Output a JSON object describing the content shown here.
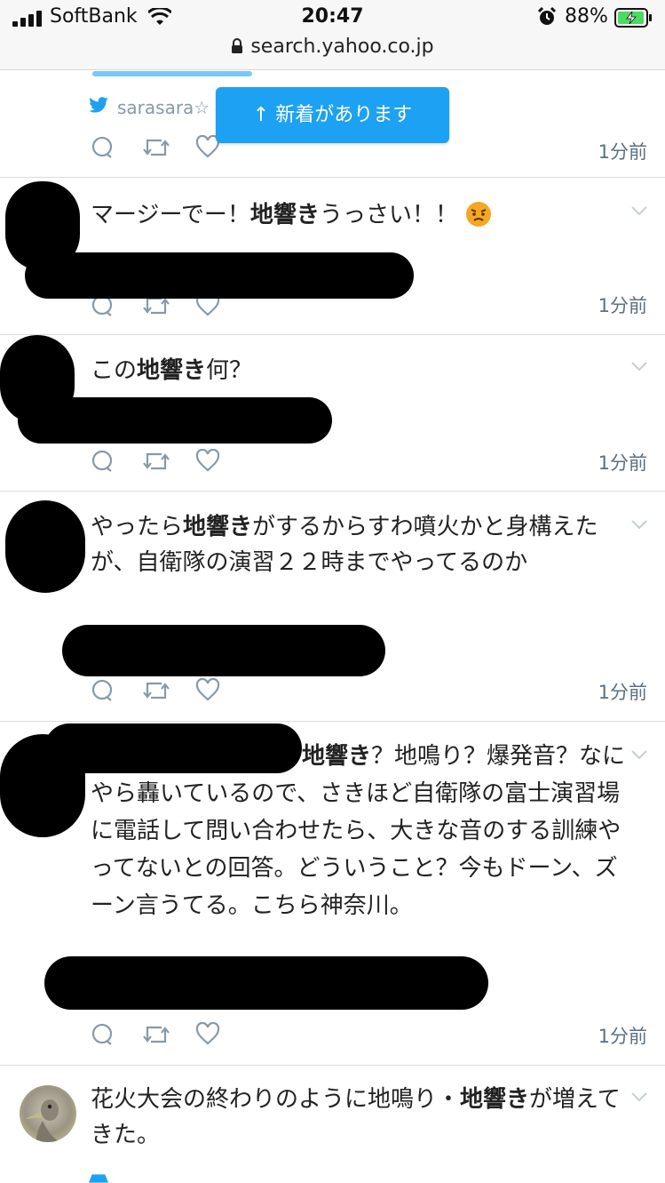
{
  "status_bar": {
    "carrier": "SoftBank",
    "time": "20:47",
    "battery": "88%",
    "url": "search.yahoo.co.jp"
  },
  "new_tweets_button": "新着があります",
  "first_tweet": {
    "source": "sarasara☆",
    "time": "1分前"
  },
  "tweets": [
    {
      "parts": [
        {
          "t": "マージーでー！",
          "b": false
        },
        {
          "t": "地響き",
          "b": true
        },
        {
          "t": "うっさい！！",
          "b": false
        }
      ],
      "emoji": "angry-face",
      "time": "1分前"
    },
    {
      "parts": [
        {
          "t": "この",
          "b": false
        },
        {
          "t": "地響き",
          "b": true
        },
        {
          "t": "何？",
          "b": false
        }
      ],
      "time": "1分前"
    },
    {
      "parts": [
        {
          "t": "やったら",
          "b": false
        },
        {
          "t": "地響き",
          "b": true
        },
        {
          "t": "がするからすわ噴火かと身構えたが、自衛隊の演習２２時までやってるのか",
          "b": false
        }
      ],
      "time": "1分前"
    },
    {
      "parts": [
        {
          "t": "地響き",
          "b": true
        },
        {
          "t": "？地鳴り？爆発音？なにやら轟いているので、さきほど自衛隊の富士演習場に電話して問い合わせたら、大きな音のする訓練やってないとの回答。どういうこと？今もドーン、ズーン言うてる。こちら神奈川。",
          "b": false
        }
      ],
      "time": "1分前"
    },
    {
      "parts": [
        {
          "t": "花火大会の終わりのように地鳴り・",
          "b": false
        },
        {
          "t": "地響き",
          "b": true
        },
        {
          "t": "が増えてきた。",
          "b": false
        }
      ]
    }
  ],
  "colors": {
    "accent": "#1da1f2",
    "muted": "#5b7083",
    "battery": "#4cd964"
  }
}
